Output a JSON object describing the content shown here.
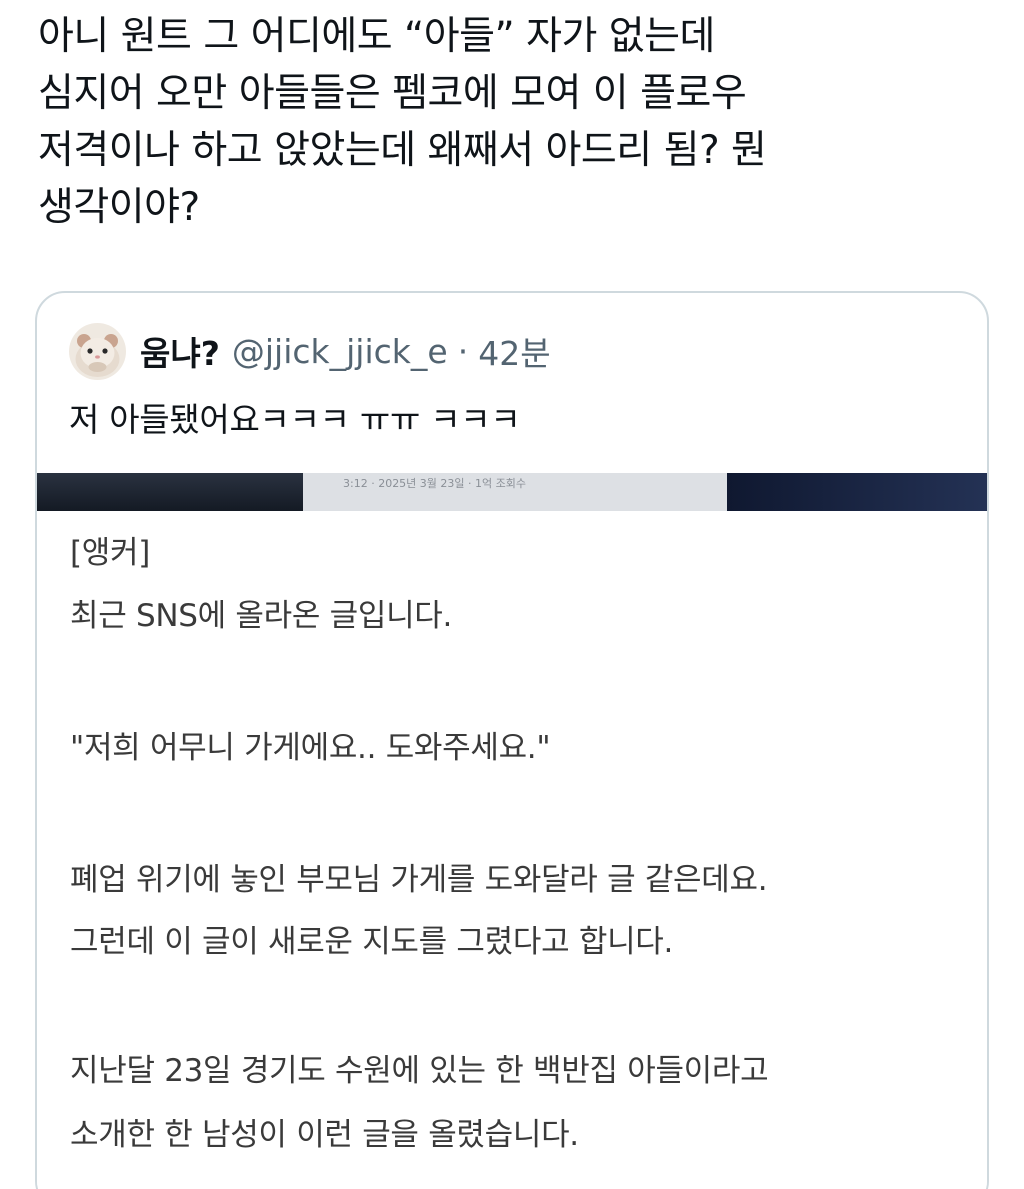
{
  "tweet": {
    "lines": [
      "아니 원트 그 어디에도 “아들” 자가 없는데",
      "심지어 오만 아들들은 펨코에 모여 이 플로우",
      "저격이나 하고 앉았는데 왜째서 아드리 됨? 뭔",
      "생각이야?"
    ]
  },
  "quote": {
    "author_name": "움냐?",
    "handle": "@jjick_jjick_e",
    "separator": "·",
    "time": "42분",
    "text": "저 아들됐어요ㅋㅋㅋ ㅠㅠ ㅋㅋㅋ",
    "media": {
      "strip_caption": "3:12 · 2025년 3월 23일 · 1억 조회수",
      "paragraphs": [
        "[앵커]",
        "최근 SNS에 올라온 글입니다.",
        "\"저희 어무니 가게에요.. 도와주세요.\"",
        "폐업 위기에 놓인 부모님 가게를 도와달라 글 같은데요.",
        "그런데 이 글이 새로운 지도를 그렸다고 합니다.",
        "지난달 23일 경기도 수원에 있는 한 백반집 아들이라고",
        "소개한 한 남성이 이런 글을 올렸습니다."
      ]
    }
  },
  "colors": {
    "text_primary": "#0f1419",
    "text_secondary": "#536471",
    "card_border": "#cfd9de",
    "article_text": "#3a3a3a"
  }
}
